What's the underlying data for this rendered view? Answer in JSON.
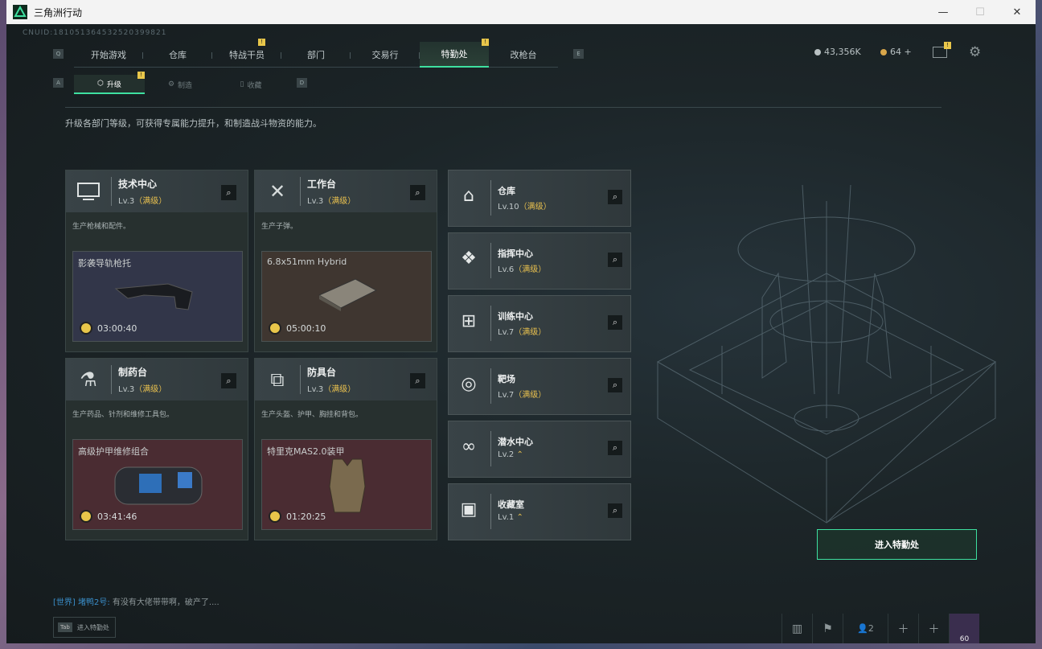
{
  "window": {
    "title": "三角洲行动",
    "controls": [
      "—",
      "☐",
      "✕"
    ]
  },
  "uid": "CNUID:181051364532520399821",
  "top_nav": {
    "key_left": "Q",
    "key_right": "E",
    "tabs": [
      {
        "label": "开始游戏"
      },
      {
        "label": "仓库"
      },
      {
        "label": "特战干员",
        "badge": "!"
      },
      {
        "label": "部门"
      },
      {
        "label": "交易行"
      },
      {
        "label": "特勤处",
        "badge": "!",
        "active": true
      },
      {
        "label": "改枪台"
      }
    ]
  },
  "currency": {
    "a": "43,356K",
    "b": "64 +"
  },
  "sub_nav": {
    "key_left": "A",
    "key_right": "D",
    "tabs": [
      {
        "label": "升级",
        "active": true,
        "badge": "!"
      },
      {
        "label": "制造"
      },
      {
        "label": "收藏"
      }
    ]
  },
  "description": "升级各部门等级，可获得专属能力提升，和制造战斗物资的能力。",
  "cards": [
    {
      "name": "技术中心",
      "level": "Lv.3",
      "max": "（满级）",
      "desc": "生产枪械和配件。",
      "item": "影袭导轨枪托",
      "timer": "03:00:40",
      "icon": "monitor-icon",
      "bg": "#2f3346"
    },
    {
      "name": "工作台",
      "level": "Lv.3",
      "max": "（满级）",
      "desc": "生产子弹。",
      "item": "6.8x51mm Hybrid",
      "timer": "05:00:10",
      "icon": "tools-icon",
      "bg": "#3e3630"
    },
    {
      "name": "制药台",
      "level": "Lv.3",
      "max": "（满级）",
      "desc": "生产药品、针剂和维修工具包。",
      "item": "高级护甲维修组合",
      "timer": "03:41:46",
      "icon": "microscope-icon",
      "bg": "#4a2c32"
    },
    {
      "name": "防具台",
      "level": "Lv.3",
      "max": "（满级）",
      "desc": "生产头盔、护甲、胸挂和背包。",
      "item": "特里克MAS2.0装甲",
      "timer": "01:20:25",
      "icon": "cubes-icon",
      "bg": "#4a2c32"
    }
  ],
  "side_cards": [
    {
      "name": "仓库",
      "level": "Lv.10",
      "max": "（满级）",
      "icon": "warehouse-icon",
      "glyph": "⌂"
    },
    {
      "name": "指挥中心",
      "level": "Lv.6",
      "max": "（满级）",
      "icon": "command-icon",
      "glyph": "❖"
    },
    {
      "name": "训练中心",
      "level": "Lv.7",
      "max": "（满级）",
      "icon": "dumbbell-icon",
      "glyph": "⊞"
    },
    {
      "name": "靶场",
      "level": "Lv.7",
      "max": "（满级）",
      "icon": "target-icon",
      "glyph": "◎"
    },
    {
      "name": "潜水中心",
      "level": "Lv.2",
      "max": "⌃",
      "icon": "goggles-icon",
      "glyph": "∞"
    },
    {
      "name": "收藏室",
      "level": "Lv.1",
      "max": "⌃",
      "icon": "vault-icon",
      "glyph": "▣"
    }
  ],
  "enter_button": "进入特勤处",
  "chat": {
    "channel": "[世界]",
    "user": "堵鸭2号:",
    "msg": "有没有大佬带带啊，破产了...."
  },
  "tab_hint": {
    "key": "Tab",
    "text": "进入特勤处"
  },
  "bottom_bar": {
    "squad_count": "2",
    "avatar_level": "60"
  },
  "colors": {
    "accent": "#3ee0a0",
    "max_level": "#e9c14f",
    "badge": "#e8c64a"
  }
}
